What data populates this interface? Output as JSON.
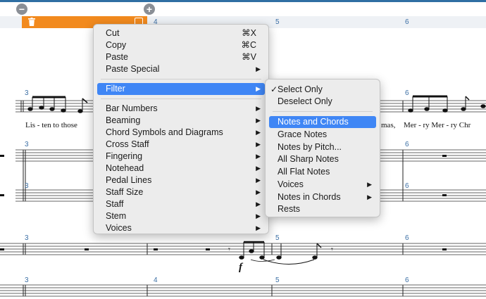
{
  "toolbar": {
    "remove_icon": "minus-circle-icon",
    "add_icon": "plus-circle-icon"
  },
  "selection": {
    "trash_icon": "trash-icon",
    "checkbox_icon": "square-icon",
    "color": "#f28a1e"
  },
  "measures": {
    "header": [
      "4",
      "5",
      "6"
    ],
    "row1": [
      "3",
      "6"
    ],
    "row2": [
      "3",
      "6"
    ],
    "row3": [
      "3",
      "6"
    ],
    "row4": [
      "3",
      "5",
      "6"
    ],
    "row5": [
      "3",
      "4",
      "5",
      "6"
    ]
  },
  "lyrics": {
    "left": "Lis - ten to those",
    "right_a": "mas,",
    "right_b": "Mer - ry Mer - ry Chr"
  },
  "dynamic": "f",
  "context_menu": {
    "items": [
      {
        "label": "Cut",
        "shortcut": "⌘X"
      },
      {
        "label": "Copy",
        "shortcut": "⌘C"
      },
      {
        "label": "Paste",
        "shortcut": "⌘V"
      },
      {
        "label": "Paste Special",
        "submenu": true
      },
      {
        "label": "Filter",
        "submenu": true,
        "highlighted": true
      },
      {
        "label": "Bar Numbers",
        "submenu": true
      },
      {
        "label": "Beaming",
        "submenu": true
      },
      {
        "label": "Chord Symbols and Diagrams",
        "submenu": true
      },
      {
        "label": "Cross Staff",
        "submenu": true
      },
      {
        "label": "Fingering",
        "submenu": true
      },
      {
        "label": "Notehead",
        "submenu": true
      },
      {
        "label": "Pedal Lines",
        "submenu": true
      },
      {
        "label": "Staff Size",
        "submenu": true
      },
      {
        "label": "Staff",
        "submenu": true
      },
      {
        "label": "Stem",
        "submenu": true
      },
      {
        "label": "Voices",
        "submenu": true
      }
    ]
  },
  "filter_menu": {
    "items": [
      {
        "label": "Select Only",
        "checked": true
      },
      {
        "label": "Deselect Only"
      },
      {
        "label": "Notes and Chords",
        "highlighted": true
      },
      {
        "label": "Grace Notes"
      },
      {
        "label": "Notes by Pitch..."
      },
      {
        "label": "All Sharp Notes"
      },
      {
        "label": "All Flat Notes"
      },
      {
        "label": "Voices",
        "submenu": true
      },
      {
        "label": "Notes in Chords",
        "submenu": true
      },
      {
        "label": "Rests"
      }
    ]
  },
  "glyphs": {
    "submenu_arrow": "▶",
    "checkmark": "✓"
  },
  "colors": {
    "menu_highlight": "#3f86f5",
    "measure_number": "#3c6fa5",
    "top_bar": "#2f6fa3"
  }
}
